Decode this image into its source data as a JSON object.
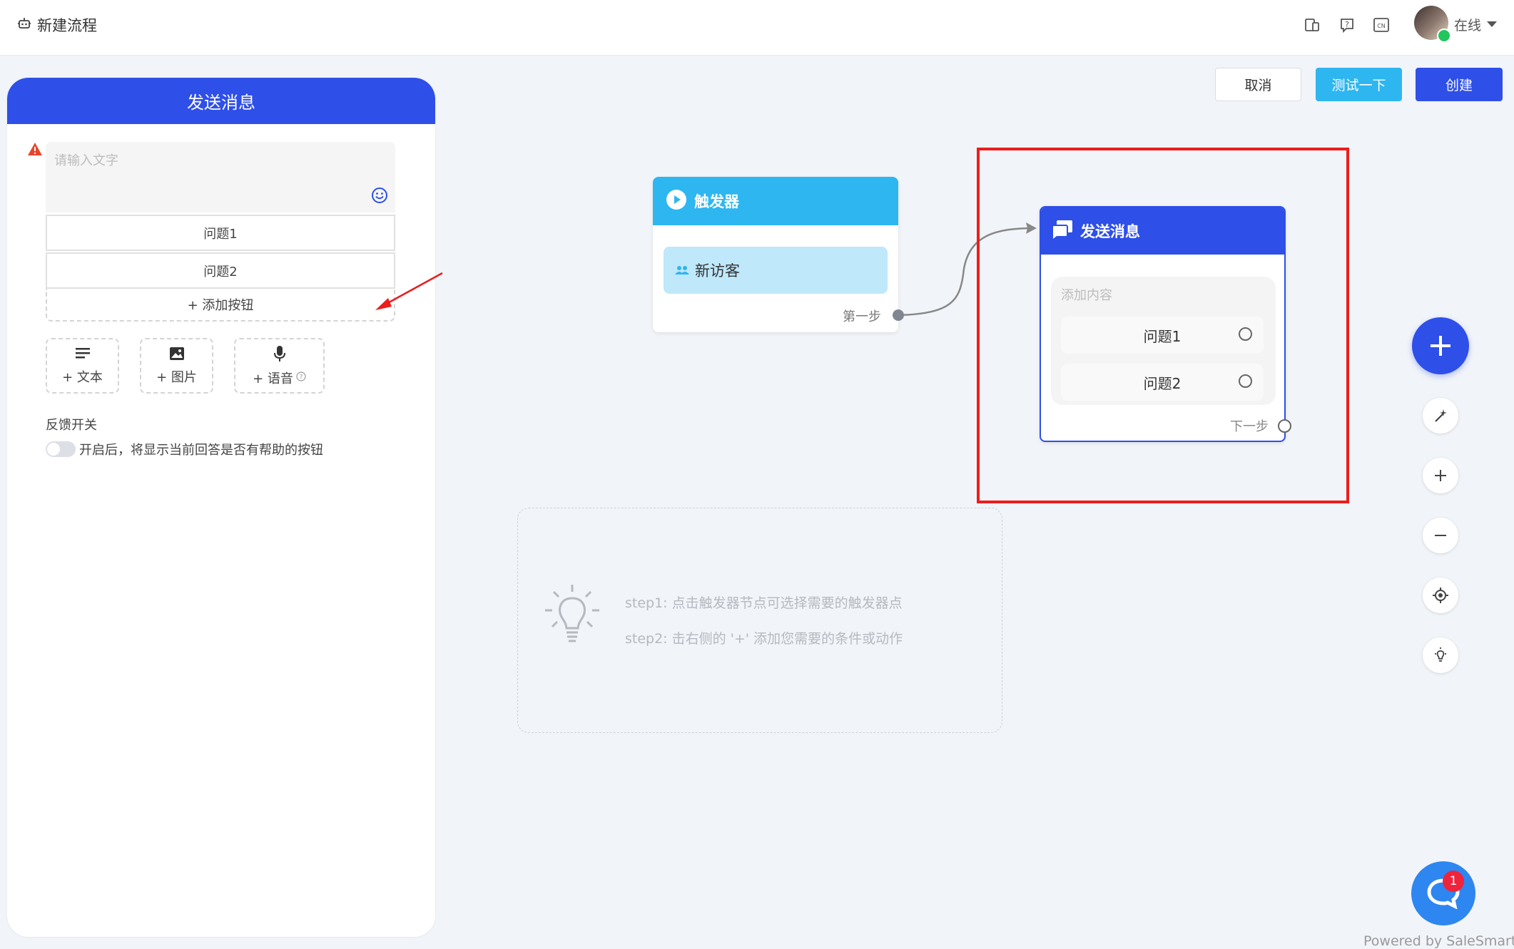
{
  "header": {
    "title": "新建流程",
    "lang_badge": "CN",
    "status": "在线"
  },
  "actions": {
    "cancel": "取消",
    "test": "测试一下",
    "create": "创建"
  },
  "panel": {
    "title": "发送消息",
    "text_placeholder": "请输入文字",
    "buttons": [
      {
        "label": "问题1"
      },
      {
        "label": "问题2"
      }
    ],
    "add_button": "+ 添加按钮",
    "tools": [
      {
        "label": "+ 文本",
        "icon": "text-lines-icon"
      },
      {
        "label": "+ 图片",
        "icon": "image-icon"
      },
      {
        "label": "+ 语音",
        "icon": "microphone-icon"
      }
    ],
    "feedback_title": "反馈开关",
    "feedback_desc": "开启后，将显示当前回答是否有帮助的按钮",
    "feedback_enabled": false
  },
  "canvas": {
    "trigger_node": {
      "title": "触发器",
      "item": "新访客",
      "step_label": "第一步"
    },
    "message_node": {
      "title": "发送消息",
      "content_placeholder": "添加内容",
      "questions": [
        {
          "label": "问题1"
        },
        {
          "label": "问题2"
        }
      ],
      "next_label": "下一步"
    },
    "tips": [
      "step1: 点击触发器节点可选择需要的触发器点",
      "step2: 击右侧的 '+' 添加您需要的条件或动作"
    ]
  },
  "chat_widget": {
    "badge_count": "1",
    "powered_by": "Powered by SaleSmartly"
  },
  "colors": {
    "primary": "#2e4fe8",
    "trigger": "#2eb6f0",
    "highlight": "#ee1c1c",
    "warning": "#e8452c"
  }
}
